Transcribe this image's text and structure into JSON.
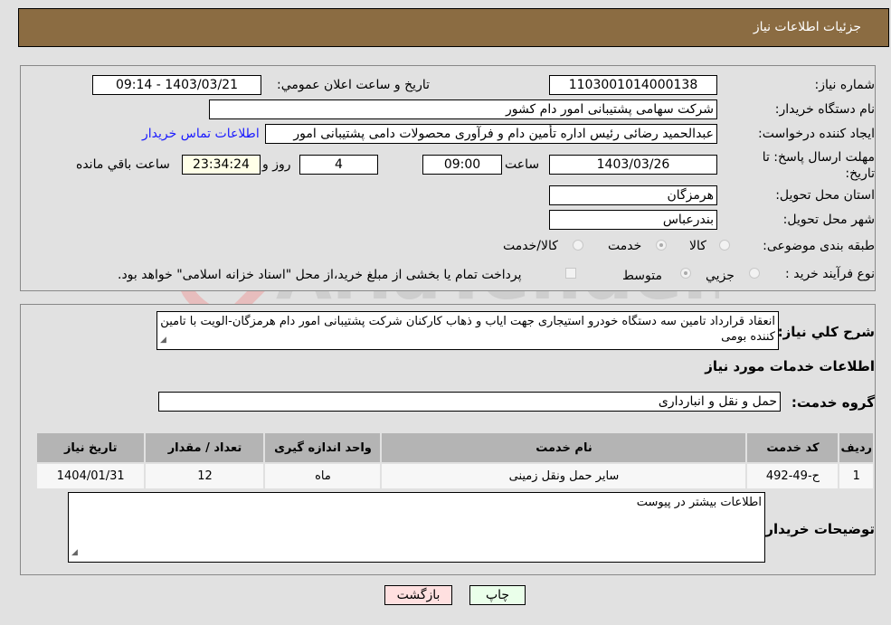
{
  "header": {
    "title": "جزئیات اطلاعات نیاز"
  },
  "details": {
    "need_number": {
      "label": "شماره نیاز:",
      "value": "1103001014000138"
    },
    "announce_datetime": {
      "label": "تاریخ و ساعت اعلان عمومي:",
      "value": "1403/03/21 - 09:14"
    },
    "buyer_org": {
      "label": "نام دستگاه خریدار:",
      "value": "شرکت سهامی پشتیبانی امور دام کشور"
    },
    "requester": {
      "label": "ایجاد کننده درخواست:",
      "value": "عبدالحمید رضائی رئیس اداره تأمین دام و فرآوری محصولات دامی پشتیبانی امور",
      "contact_link": "اطلاعات تماس خریدار"
    },
    "deadline": {
      "label": "مهلت ارسال پاسخ: تا تاریخ:",
      "date": "1403/03/26",
      "time_label": "ساعت",
      "time": "09:00",
      "days": "4",
      "days_label": "روز و",
      "remaining": "23:34:24",
      "remaining_label": "ساعت باقي مانده"
    },
    "province": {
      "label": "استان محل تحویل:",
      "value": "هرمزگان"
    },
    "city": {
      "label": "شهر محل تحویل:",
      "value": "بندرعباس"
    },
    "category": {
      "label": "طبقه بندی موضوعی:",
      "options": [
        "کالا",
        "خدمت",
        "کالا/خدمت"
      ],
      "selected": "خدمت"
    },
    "process": {
      "label": "نوع فرآیند خرید :",
      "options": [
        "جزيي",
        "متوسط"
      ],
      "selected": "متوسط",
      "treasury_note": "پرداخت تمام یا بخشی از مبلغ خرید،از محل \"اسناد خزانه اسلامی\" خواهد بود."
    }
  },
  "description": {
    "label": "شرح کلي نیاز:",
    "value": "انعقاد قرارداد تامین سه دستگاه خودرو استیجاری جهت ایاب و ذهاب کارکنان شرکت پشتیبانی امور دام هرمزگان-الویت با تامین کننده بومی"
  },
  "services": {
    "section_title": "اطلاعات خدمات مورد نیاز",
    "group_label": "گروه خدمت:",
    "group_value": "حمل و نقل و انبارداری",
    "columns": [
      "ردیف",
      "کد خدمت",
      "نام خدمت",
      "واحد اندازه گیری",
      "تعداد / مقدار",
      "تاریخ نیاز"
    ],
    "rows": [
      [
        "1",
        "ح-49-492",
        "سایر حمل ونقل زمینی",
        "ماه",
        "12",
        "1404/01/31"
      ]
    ]
  },
  "buyer_notes": {
    "label": "توضیحات خریدار:",
    "value": "اطلاعات بیشتر در پیوست"
  },
  "buttons": {
    "print": "چاپ",
    "back": "بازگشت"
  },
  "watermark": {
    "text": "AriaTender.neT"
  },
  "colors": {
    "header_bg": "#8b6c42",
    "print_bg": "#eaffea",
    "back_bg": "#ffe0e0",
    "remaining_bg": "#ffffe8"
  }
}
